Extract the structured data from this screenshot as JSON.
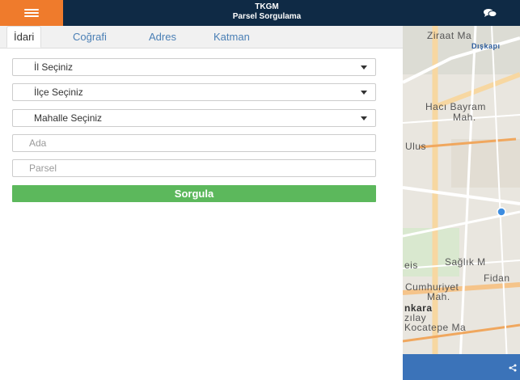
{
  "header": {
    "title_line1": "TKGM",
    "title_line2": "Parsel Sorgulama",
    "menu_icon": "hamburger-icon",
    "chat_icon": "chat-icon",
    "accent_color": "#ef7b2c",
    "bar_color": "#0f2a45"
  },
  "tabs": [
    {
      "label": "İdari"
    },
    {
      "label": "Coğrafi"
    },
    {
      "label": "Adres"
    },
    {
      "label": "Katman"
    }
  ],
  "form": {
    "province": "İl Seçiniz",
    "district": "İlçe Seçiniz",
    "neighborhood": "Mahalle Seçiniz",
    "block_placeholder": "Ada",
    "parcel_placeholder": "Parsel",
    "submit_label": "Sorgula",
    "submit_color": "#5cb85c"
  },
  "map": {
    "labels": {
      "ziraat": "Ziraat Ma",
      "diskapi": "Dışkapı",
      "haci": "Hacı Bayram",
      "mah1": "Mah.",
      "ulus": "Ulus",
      "saglik": "Sağlık M",
      "eis": "eis",
      "fidan": "Fidan",
      "cumhuriyet": "Cumhuriyet",
      "mah2": "Mah.",
      "nkara": "nkara",
      "kizilay": "zılay",
      "kocatepe": "Kocatepe Ma"
    }
  }
}
